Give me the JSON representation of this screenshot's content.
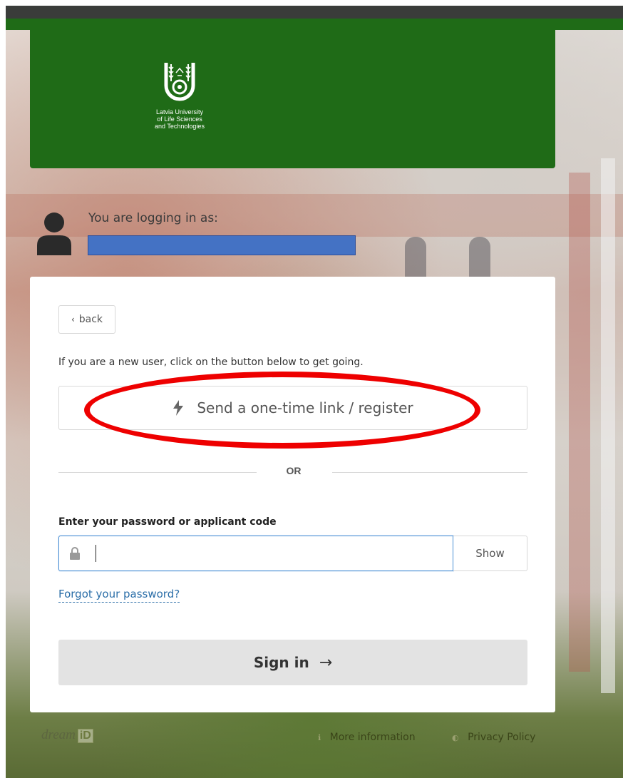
{
  "brand": {
    "university_name": [
      "Latvia University",
      "of Life Sciences",
      "and Technologies"
    ],
    "color": "#1f6b17"
  },
  "user": {
    "logging_in_label": "You are logging in as:",
    "email_redacted": ""
  },
  "login": {
    "back_label": "back",
    "intro_text": "If you are a new user, click on the button below to get going.",
    "one_time_link_label": "Send a one-time link / register",
    "or_label": "OR",
    "password_label": "Enter your password or applicant code",
    "password_value": "",
    "show_label": "Show",
    "forgot_label": "Forgot your password?",
    "signin_label": "Sign in"
  },
  "footer": {
    "brand_word": "dream",
    "brand_id": "iD",
    "more_info_label": "More information",
    "privacy_label": "Privacy Policy"
  },
  "icons": {
    "back": "chevron-left-icon",
    "one_time_link": "lightning-bolt-icon",
    "password": "lock-icon",
    "signin": "arrow-right-icon",
    "more_info": "info-icon",
    "privacy": "shield-icon"
  },
  "colors": {
    "header_green": "#1f6b17",
    "link_blue": "#2b6ea8",
    "highlight_red": "#ee0000",
    "redaction_blue": "#4472c4"
  }
}
